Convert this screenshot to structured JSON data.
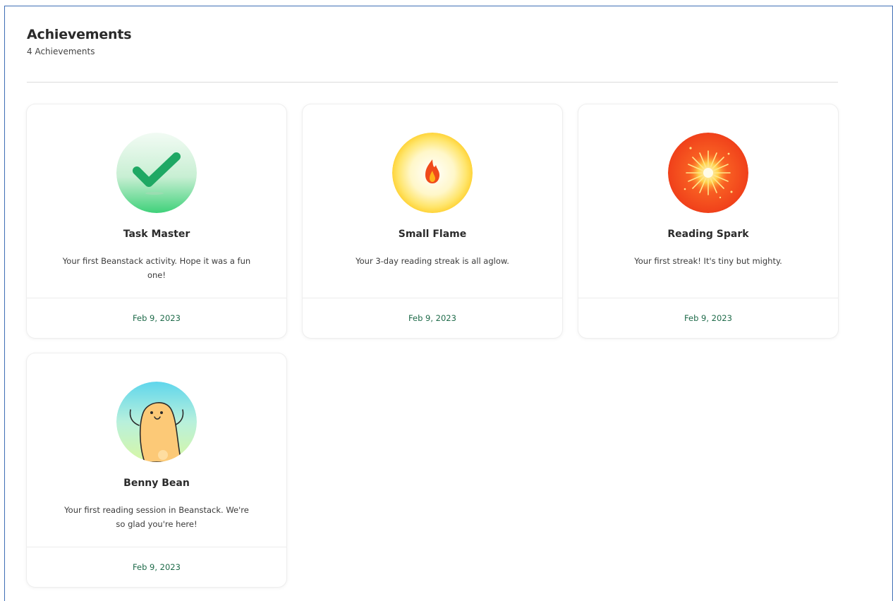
{
  "header": {
    "title": "Achievements",
    "count": "4 Achievements"
  },
  "achievements": [
    {
      "title": "Task Master",
      "description": "Your first Beanstack activity. Hope it was a fun one!",
      "date": "Feb 9, 2023",
      "icon": "checkmark-badge-icon"
    },
    {
      "title": "Small Flame",
      "description": "Your 3-day reading streak is all aglow.",
      "date": "Feb 9, 2023",
      "icon": "flame-badge-icon"
    },
    {
      "title": "Reading Spark",
      "description": "Your first streak! It's tiny but mighty.",
      "date": "Feb 9, 2023",
      "icon": "spark-badge-icon"
    },
    {
      "title": "Benny Bean",
      "description": "Your first reading session in Beanstack. We're so glad you're here!",
      "date": "Feb 9, 2023",
      "icon": "bean-character-badge-icon"
    }
  ],
  "colors": {
    "frame_border": "#3f6fb5",
    "date_text": "#1f6b4a",
    "check_green": "#1fa864",
    "flame_orange": "#f04a1a",
    "spark_red": "#f2481c"
  }
}
